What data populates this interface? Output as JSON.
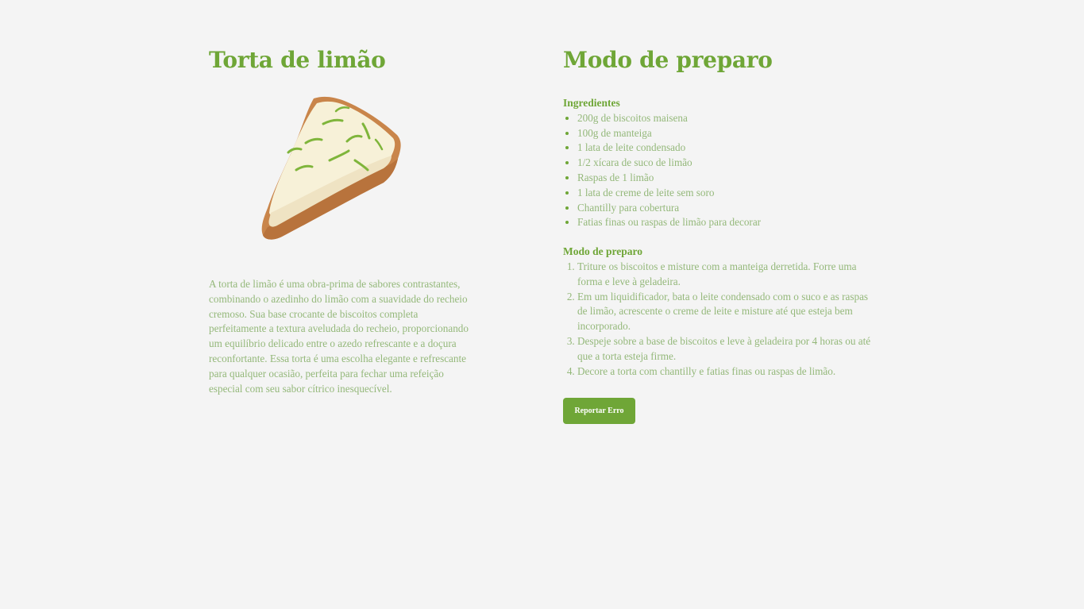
{
  "recipe": {
    "title": "Torta de limão",
    "image_alt": "Fatia de torta de limão",
    "description": "A torta de limão é uma obra-prima de sabores contrastantes, combinando o azedinho do limão com a suavidade do recheio cremoso. Sua base crocante de biscoitos completa perfeitamente a textura aveludada do recheio, proporcionando um equilíbrio delicado entre o azedo refrescante e a doçura reconfortante. Essa torta é uma escolha elegante e refrescante para qualquer ocasião, perfeita para fechar uma refeição especial com seu sabor cítrico inesquecível."
  },
  "preparation": {
    "heading": "Modo de preparo",
    "ingredients_title": "Ingredientes",
    "ingredients": [
      "200g de biscoitos maisena",
      "100g de manteiga",
      "1 lata de leite condensado",
      "1/2 xícara de suco de limão",
      "Raspas de 1 limão",
      "1 lata de creme de leite sem soro",
      "Chantilly para cobertura",
      "Fatias finas ou raspas de limão para decorar"
    ],
    "steps_title": "Modo de preparo",
    "steps": [
      "Triture os biscoitos e misture com a manteiga derretida. Forre uma forma e leve à geladeira.",
      "Em um liquidificador, bata o leite condensado com o suco e as raspas de limão, acrescente o creme de leite e misture até que esteja bem incorporado.",
      "Despeje sobre a base de biscoitos e leve à geladeira por 4 horas ou até que a torta esteja firme.",
      "Decore a torta com chantilly e fatias finas ou raspas de limão."
    ],
    "report_button": "Reportar Erro"
  },
  "colors": {
    "accent": "#6fa637",
    "text": "#94b87a",
    "background": "#f4f4f4"
  }
}
